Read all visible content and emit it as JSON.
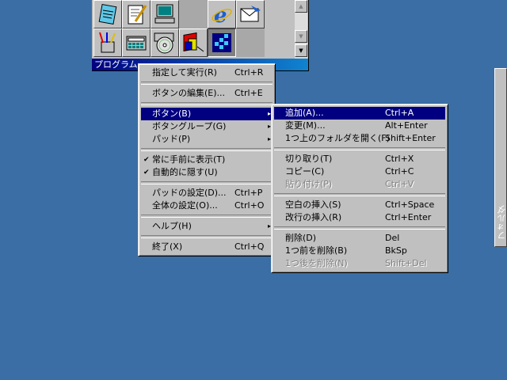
{
  "pad": {
    "title": "プログラム",
    "scroll_up": "▲",
    "scroll_mid": "▼",
    "scroll_down": "▼",
    "icons": [
      "notepad-icon",
      "wordpad-icon",
      "my-computer-icon",
      "empty",
      "internet-explorer-icon",
      "outlook-express-icon",
      "paint-icon",
      "calculator-icon",
      "cd-player-icon",
      "media-player-icon",
      "task-scheduler-icon",
      "empty"
    ]
  },
  "main_menu": {
    "items": [
      {
        "label": "指定して実行(R)",
        "shortcut": "Ctrl+R"
      },
      {
        "label": "ボタンの編集(E)...",
        "shortcut": "Ctrl+E"
      },
      {
        "label": "ボタン(B)",
        "shortcut": "▸"
      },
      {
        "label": "ボタングループ(G)",
        "shortcut": "▸"
      },
      {
        "label": "パッド(P)",
        "shortcut": "▸"
      },
      {
        "label": "常に手前に表示(T)",
        "shortcut": ""
      },
      {
        "label": "自動的に隠す(U)",
        "shortcut": ""
      },
      {
        "label": "パッドの設定(D)...",
        "shortcut": "Ctrl+P"
      },
      {
        "label": "全体の設定(O)...",
        "shortcut": "Ctrl+O"
      },
      {
        "label": "ヘルプ(H)",
        "shortcut": "▸"
      },
      {
        "label": "終了(X)",
        "shortcut": "Ctrl+Q"
      }
    ],
    "check_mark": "✔"
  },
  "sub_menu": {
    "items": [
      {
        "label": "追加(A)...",
        "shortcut": "Ctrl+A"
      },
      {
        "label": "変更(M)...",
        "shortcut": "Alt+Enter"
      },
      {
        "label": "1つ上のフォルダを開く(F)",
        "shortcut": "Shift+Enter"
      },
      {
        "label": "切り取り(T)",
        "shortcut": "Ctrl+X"
      },
      {
        "label": "コピー(C)",
        "shortcut": "Ctrl+C"
      },
      {
        "label": "貼り付け(P)",
        "shortcut": "Ctrl+V"
      },
      {
        "label": "空白の挿入(S)",
        "shortcut": "Ctrl+Space"
      },
      {
        "label": "改行の挿入(R)",
        "shortcut": "Ctrl+Enter"
      },
      {
        "label": "削除(D)",
        "shortcut": "Del"
      },
      {
        "label": "1つ前を削除(B)",
        "shortcut": "BkSp"
      },
      {
        "label": "1つ後を削除(N)",
        "shortcut": "Shift+Del"
      }
    ]
  },
  "folder_tab": {
    "label": "フォルダ"
  },
  "colors": {
    "desktop": "#3a6ea5",
    "highlight": "#000080",
    "face": "#c0c0c0"
  }
}
